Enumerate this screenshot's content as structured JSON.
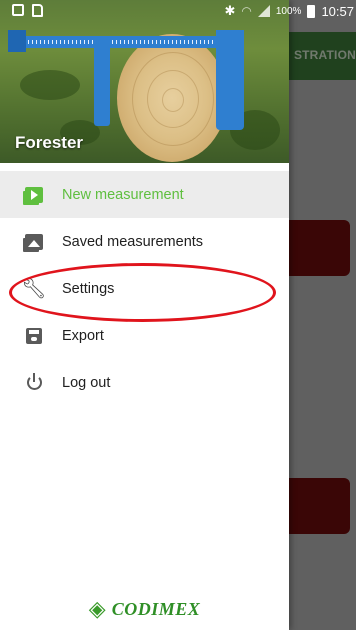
{
  "status_bar": {
    "battery": "100%",
    "time": "10:57"
  },
  "background_app": {
    "toolbar_title": "STRATION",
    "toolbar_color": "#3f7d3b",
    "card_color": "#6f0d0d"
  },
  "drawer": {
    "header_title": "Forester",
    "items": [
      {
        "label": "New measurement",
        "icon": "new-measurement-icon",
        "active": true
      },
      {
        "label": "Saved measurements",
        "icon": "photo-library-icon",
        "active": false
      },
      {
        "label": "Settings",
        "icon": "wrench-icon",
        "active": false
      },
      {
        "label": "Export",
        "icon": "save-icon",
        "active": false
      },
      {
        "label": "Log out",
        "icon": "power-icon",
        "active": false
      }
    ],
    "accent_color": "#5fbf3f",
    "highlight_color": "#e0141c"
  },
  "brand": {
    "text": "CODIMEX"
  }
}
